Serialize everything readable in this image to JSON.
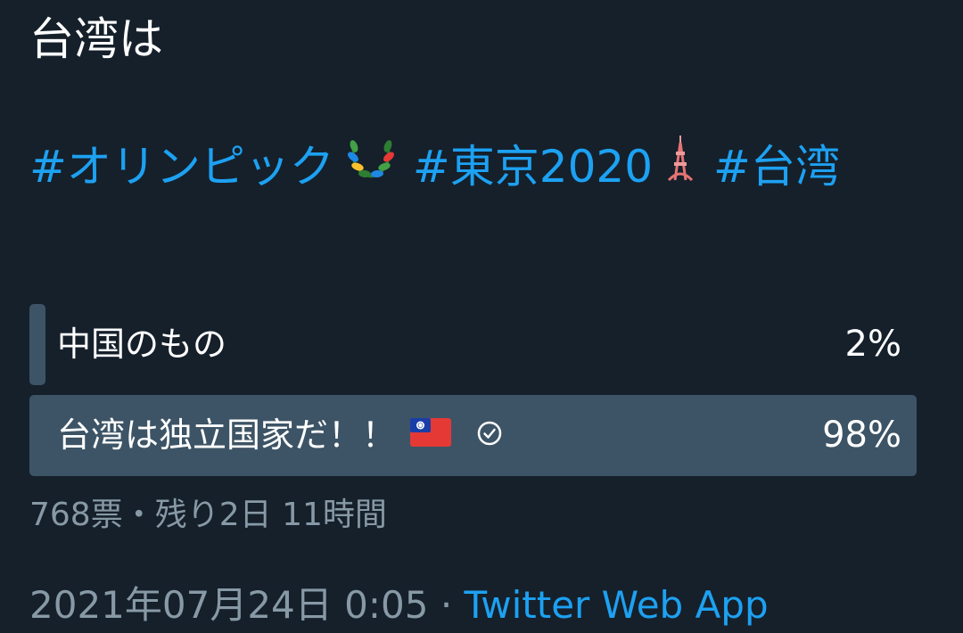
{
  "tweet": {
    "text": "台湾は",
    "hashtags": [
      "#オリンピック",
      "#東京2020",
      "#台湾"
    ],
    "emojis": [
      "laurel-wreath-icon",
      "tokyo-tower-icon"
    ]
  },
  "poll": {
    "options": [
      {
        "label": "中国のもの",
        "percent": "2%",
        "fraction": 0.02,
        "selected": false
      },
      {
        "label": "台湾は独立国家だ！！",
        "percent": "98%",
        "fraction": 0.98,
        "selected": true,
        "icons": [
          "taiwan-flag-icon",
          "check-circle-icon"
        ]
      }
    ],
    "votes": "768票",
    "separator": "・",
    "remaining": "残り2日 11時間"
  },
  "meta": {
    "timestamp": "2021年07月24日 0:05",
    "separator": "·",
    "source": "Twitter Web App"
  },
  "colors": {
    "background": "#15202b",
    "link": "#1da1f2",
    "poll_bar": "#3d5466",
    "secondary_text": "#8899a6"
  }
}
